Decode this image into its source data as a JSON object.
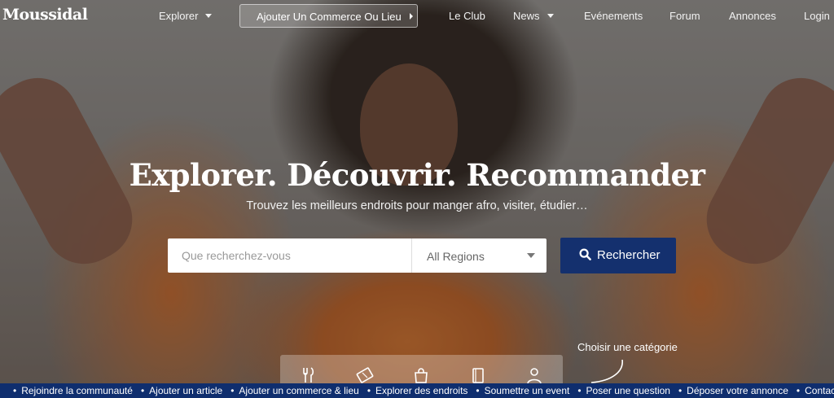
{
  "brand": {
    "logo": "Moussidal"
  },
  "nav": {
    "explorer": "Explorer",
    "add_business": "Ajouter Un Commerce Ou Lieu",
    "club": "Le Club",
    "news": "News",
    "events": "Evénements",
    "forum": "Forum",
    "ads": "Annonces",
    "login": "Login"
  },
  "hero": {
    "headline": "Explorer. Découvrir. Recommander",
    "subline": "Trouvez les meilleurs endroits pour manger afro, visiter, étudier…"
  },
  "search": {
    "placeholder": "Que recherchez-vous",
    "region": "All Regions",
    "button": "Rechercher"
  },
  "categories": {
    "label": "Choisir une catégorie",
    "icons": [
      "fork-knife-icon",
      "ticket-icon",
      "shopping-bag-icon",
      "book-icon",
      "person-icon"
    ]
  },
  "ticker": {
    "items": [
      "Rejoindre la communauté",
      "Ajouter un article",
      "Ajouter un commerce & lieu",
      "Explorer des endroits",
      "Soumettre un event",
      "Poser une question",
      "Déposer votre annonce",
      "Contact"
    ]
  },
  "colors": {
    "primary": "#14306e",
    "ticker": "#0f2e6e"
  }
}
